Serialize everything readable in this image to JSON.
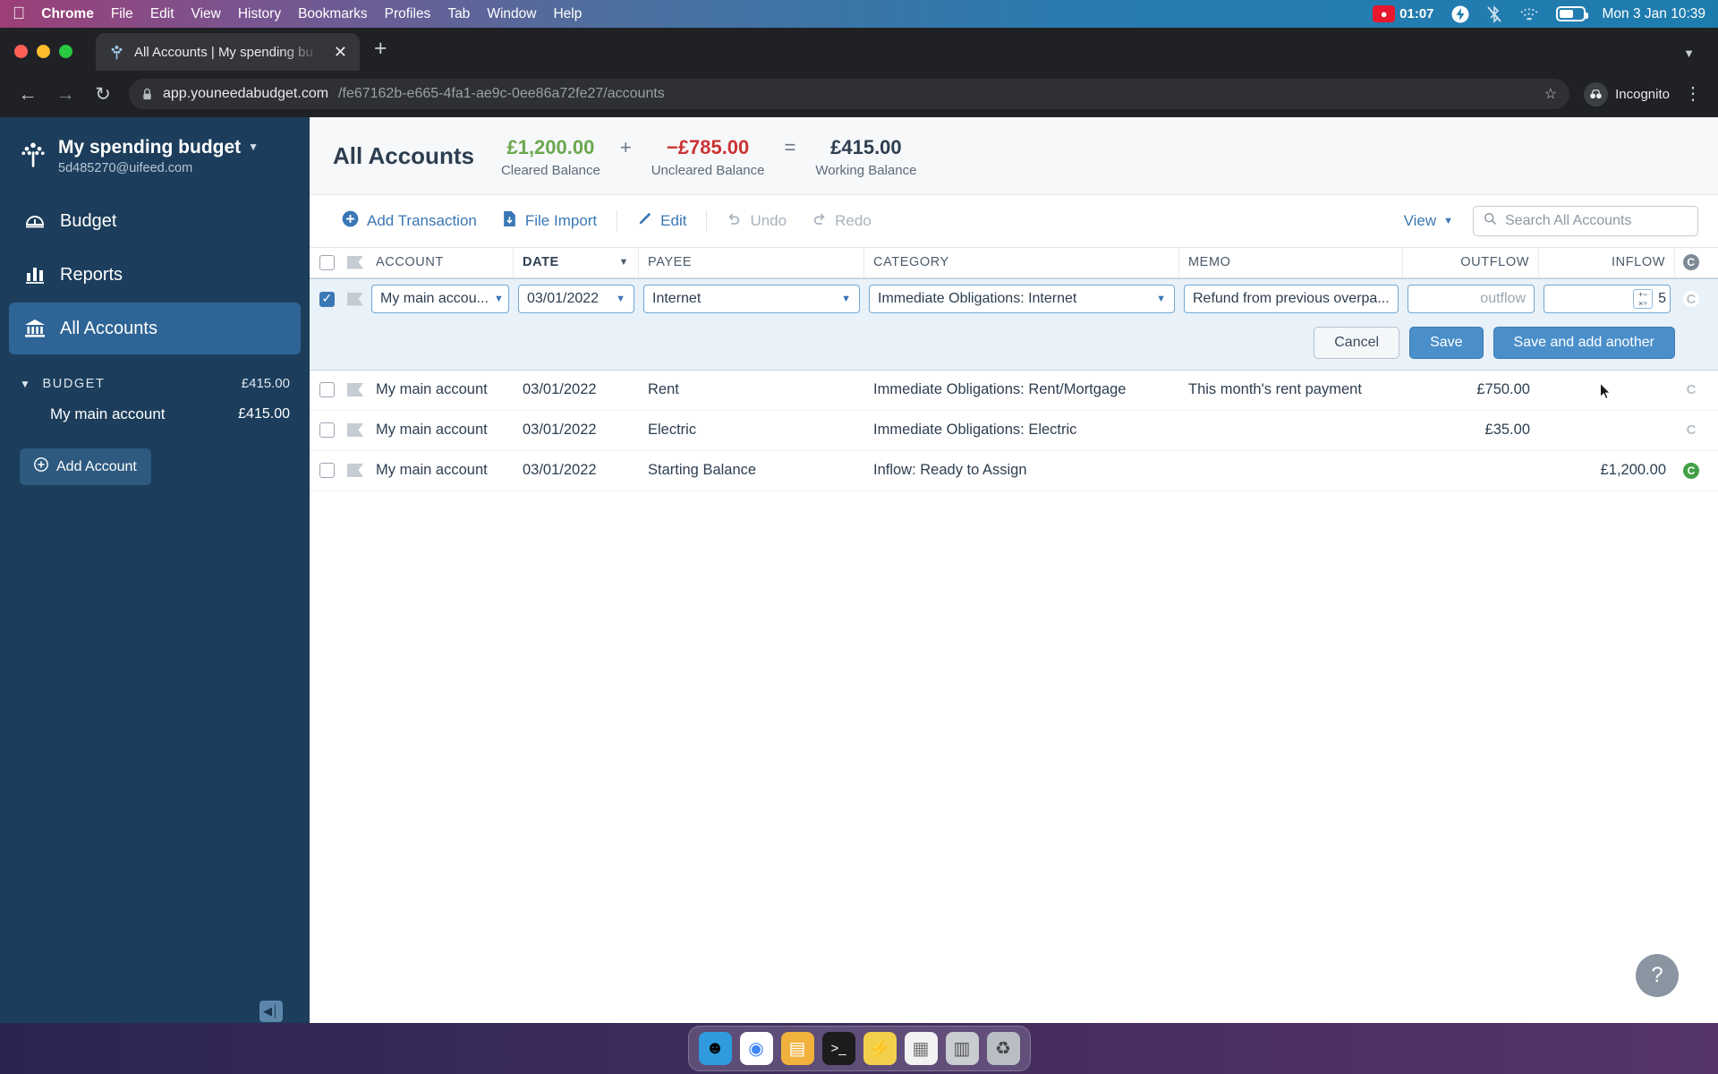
{
  "menubar": {
    "apple": "apple-logo",
    "items": [
      {
        "label": "Chrome",
        "bold": true
      },
      {
        "label": "File",
        "bold": false
      },
      {
        "label": "Edit",
        "bold": false
      },
      {
        "label": "View",
        "bold": false
      },
      {
        "label": "History",
        "bold": false
      },
      {
        "label": "Bookmarks",
        "bold": false
      },
      {
        "label": "Profiles",
        "bold": false
      },
      {
        "label": "Tab",
        "bold": false
      },
      {
        "label": "Window",
        "bold": false
      },
      {
        "label": "Help",
        "bold": false
      }
    ],
    "recording_time": "01:07",
    "clock": "Mon 3 Jan  10:39"
  },
  "browser": {
    "tab_title": "All Accounts | My spending bu",
    "url_host": "app.youneedabudget.com",
    "url_path": "/fe67162b-e665-4fa1-ae9c-0ee86a72fe27/accounts",
    "profile_label": "Incognito"
  },
  "sidebar": {
    "budget_name": "My spending budget",
    "budget_email": "5d485270@uifeed.com",
    "nav": [
      {
        "label": "Budget",
        "icon": "budget-icon",
        "active": false
      },
      {
        "label": "Reports",
        "icon": "reports-icon",
        "active": false
      },
      {
        "label": "All Accounts",
        "icon": "bank-icon",
        "active": true
      }
    ],
    "section_label": "BUDGET",
    "section_amount": "£415.00",
    "accounts": [
      {
        "name": "My main account",
        "amount": "£415.00"
      }
    ],
    "add_account_label": "Add Account"
  },
  "header": {
    "title": "All Accounts",
    "balances": [
      {
        "amount": "£1,200.00",
        "label": "Cleared Balance",
        "color": "#6aa84f"
      },
      {
        "amount": "−£785.00",
        "label": "Uncleared Balance",
        "color": "#cc3333"
      },
      {
        "amount": "£415.00",
        "label": "Working Balance",
        "color": "#2d3e50"
      }
    ],
    "op1": "+",
    "op2": "="
  },
  "toolbar": {
    "add_transaction": "Add Transaction",
    "file_import": "File Import",
    "edit": "Edit",
    "undo": "Undo",
    "redo": "Redo",
    "view": "View",
    "search_placeholder": "Search All Accounts"
  },
  "table": {
    "columns": {
      "account": "ACCOUNT",
      "date": "DATE",
      "payee": "PAYEE",
      "category": "CATEGORY",
      "memo": "MEMO",
      "outflow": "OUTFLOW",
      "inflow": "INFLOW"
    },
    "edit_row": {
      "account": "My main accou...",
      "date": "03/01/2022",
      "payee": "Internet",
      "category": "Immediate Obligations: Internet",
      "memo": "Refund from previous overpa...",
      "outflow_placeholder": "outflow",
      "inflow": "5",
      "cancel": "Cancel",
      "save": "Save",
      "save_and_add": "Save and add another"
    },
    "rows": [
      {
        "account": "My main account",
        "date": "03/01/2022",
        "payee": "Rent",
        "category": "Immediate Obligations: Rent/Mortgage",
        "memo": "This month's rent payment",
        "outflow": "£750.00",
        "inflow": "",
        "cleared": "C",
        "cleared_state": "uncleared"
      },
      {
        "account": "My main account",
        "date": "03/01/2022",
        "payee": "Electric",
        "category": "Immediate Obligations: Electric",
        "memo": "",
        "outflow": "£35.00",
        "inflow": "",
        "cleared": "C",
        "cleared_state": "uncleared"
      },
      {
        "account": "My main account",
        "date": "03/01/2022",
        "payee": "Starting Balance",
        "category": "Inflow: Ready to Assign",
        "memo": "",
        "outflow": "",
        "inflow": "£1,200.00",
        "cleared": "C",
        "cleared_state": "cleared"
      }
    ]
  },
  "help_button": "?",
  "dock": [
    {
      "name": "finder-icon",
      "glyph": "🙂",
      "color": "#2f9bde"
    },
    {
      "name": "chrome-icon",
      "glyph": "◉",
      "color": "#ffffff"
    },
    {
      "name": "files-icon",
      "glyph": "▤",
      "color": "#f0b23c"
    },
    {
      "name": "terminal-icon",
      "glyph": "▸",
      "color": "#1c1c1c"
    },
    {
      "name": "bolt-icon",
      "glyph": "⚡",
      "color": "#f2d04b"
    },
    {
      "name": "notes-icon",
      "glyph": "▦",
      "color": "#f2f2f2"
    },
    {
      "name": "calculator-icon",
      "glyph": "▥",
      "color": "#c9ccd1"
    },
    {
      "name": "trash-icon",
      "glyph": "🗑",
      "color": "#b9bec4"
    }
  ]
}
